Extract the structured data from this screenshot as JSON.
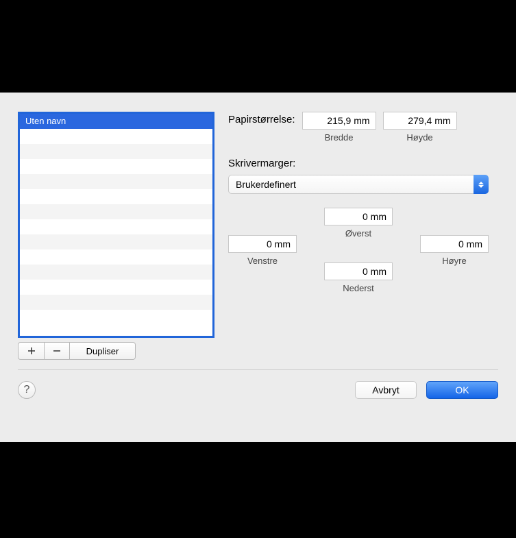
{
  "sidebar": {
    "items": [
      {
        "label": "Uten navn",
        "selected": true
      }
    ],
    "toolbar": {
      "add_icon": "plus",
      "remove_icon": "minus",
      "duplicate_label": "Dupliser"
    }
  },
  "paper_size": {
    "label": "Papirstørrelse:",
    "width": "215,9 mm",
    "width_label": "Bredde",
    "height": "279,4 mm",
    "height_label": "Høyde"
  },
  "margins": {
    "label": "Skrivermarger:",
    "preset": "Brukerdefinert",
    "top_value": "0 mm",
    "top_label": "Øverst",
    "left_value": "0 mm",
    "left_label": "Venstre",
    "right_value": "0 mm",
    "right_label": "Høyre",
    "bottom_value": "0 mm",
    "bottom_label": "Nederst"
  },
  "footer": {
    "help": "?",
    "cancel": "Avbryt",
    "ok": "OK"
  }
}
